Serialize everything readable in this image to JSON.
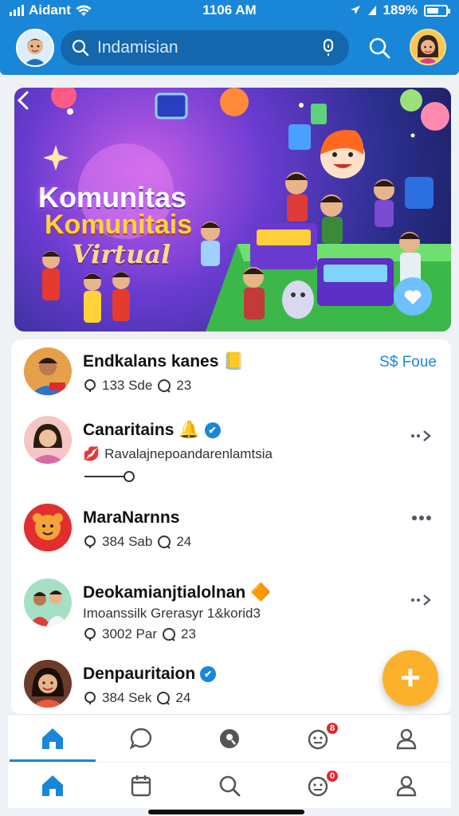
{
  "status_bar": {
    "carrier": "Aidant",
    "time": "1106 AM",
    "battery": "189%"
  },
  "header": {
    "search_text": "Indamisian",
    "avatar_left_icon": "user-avatar",
    "avatar_right_icon": "user-avatar"
  },
  "banner": {
    "line1": "Komunitas",
    "line2": "Komunitais",
    "line3": "Virtual"
  },
  "feed": [
    {
      "name": "Endkalans kanes",
      "badge_emoji": "📒",
      "stat1": "133 Sde",
      "stat2": "23",
      "action": "S$ Foue",
      "avatar_color": "#e5a04a"
    },
    {
      "name": "Canaritains",
      "badge_emoji": "🔔",
      "verified": "✔",
      "subtitle_emoji": "💋",
      "subtitle": "Ravalajnepoandarenlamtsia",
      "avatar_color": "#f4c6c6"
    },
    {
      "name": "MaraNarnns",
      "stat1": "384 Sab",
      "stat2": "24",
      "avatar_color": "#e22e2e"
    },
    {
      "name": "Deokamianjtialolnan",
      "badge_emoji": "🔶",
      "subtitle": "Imoanssilk Grerasyr 1&korid3",
      "stat1": "3002 Par",
      "stat2": "23",
      "avatar_color": "#7ec3a0"
    },
    {
      "name": "Denpauritaion",
      "verified": "✔",
      "stat1": "384 Sek",
      "stat2": "24",
      "avatar_color": "#6b3b2a"
    }
  ],
  "fab": {
    "label": "+"
  },
  "nav_top": [
    {
      "icon": "home-icon"
    },
    {
      "icon": "chat-icon"
    },
    {
      "icon": "explore-icon"
    },
    {
      "icon": "notifications-icon",
      "badge": "8"
    },
    {
      "icon": "profile-icon"
    }
  ],
  "nav_bottom": [
    {
      "icon": "home-icon"
    },
    {
      "icon": "calendar-icon"
    },
    {
      "icon": "search-icon"
    },
    {
      "icon": "notifications-icon",
      "badge": "0"
    },
    {
      "icon": "profile-icon"
    }
  ],
  "colors": {
    "accent": "#1a86d8",
    "fab": "#fbb12c",
    "badge": "#e0262c"
  }
}
